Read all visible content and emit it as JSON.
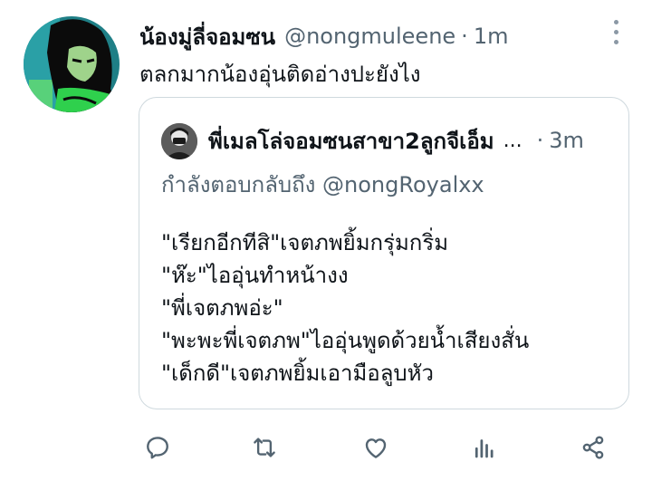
{
  "tweet": {
    "display_name": "น้องมู่ลี่จอมซน",
    "handle": "@nongmuleene",
    "separator": "·",
    "time": "1m",
    "text": "ตลกมากน้องอุ่นติดอ่างปะยังไง"
  },
  "quote": {
    "display_name": "พี่เมลโล่จอมซนสาขา2ลูกจีเอ็ม",
    "ellipsis": "...",
    "separator": "·",
    "time": "3m",
    "reply_prefix": "กำลังตอบกลับถึง",
    "reply_mention": "@nongRoyalxx",
    "lines": [
      "\"เรียกอีกทีสิ\"เจตภพยิ้มกรุ่มกริ่ม",
      "\"ห๊ะ\"ไออุ่นทำหน้างง",
      "\"พี่เจตภพอ่ะ\"",
      "\"พะพะพี่เจตภพ\"ไออุ่นพูดด้วยน้ำเสียงสั่น",
      "\"เด็กดี\"เจตภพยิ้มเอามือลูบหัว"
    ]
  },
  "actions": [
    {
      "name": "reply-icon"
    },
    {
      "name": "retweet-icon"
    },
    {
      "name": "like-icon"
    },
    {
      "name": "views-icon"
    },
    {
      "name": "share-icon"
    }
  ],
  "colors": {
    "text_primary": "#0f1419",
    "text_secondary": "#536471",
    "border": "#cfd9de",
    "icon": "#536471"
  }
}
